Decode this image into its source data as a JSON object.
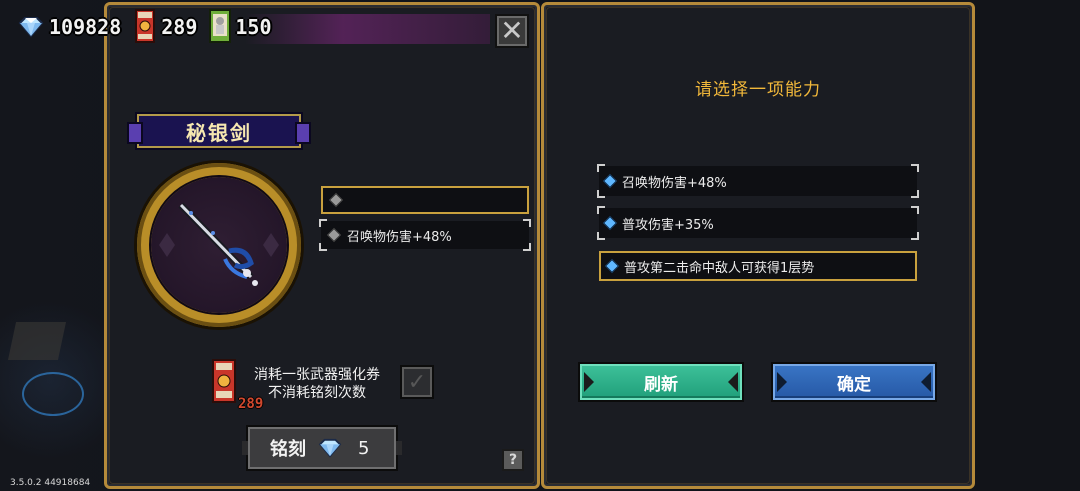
{
  "currencies": {
    "gems": "109828",
    "tickets": "289",
    "cards": "150"
  },
  "left_panel": {
    "weapon_name": "秘银剑",
    "slots": [
      {
        "text": ""
      },
      {
        "text": "召唤物伤害+48%"
      }
    ],
    "consume_line1": "消耗一张武器强化券",
    "consume_line2": "不消耗铭刻次数",
    "consume_ticket_count": "289",
    "engrave_label": "铭刻",
    "engrave_cost": "5",
    "help_label": "?"
  },
  "right_panel": {
    "title": "请选择一项能力",
    "options": [
      {
        "text": "召唤物伤害+48%"
      },
      {
        "text": "普攻伤害+35%"
      },
      {
        "text": "普攻第二击命中敌人可获得1层势"
      }
    ],
    "refresh_label": "刷新",
    "confirm_label": "确定"
  },
  "version": "3.5.0.2 44918684",
  "colors": {
    "gold_border": "#b58a3a",
    "title_orange": "#f2b83a",
    "refresh_green": "#2fb489",
    "confirm_blue": "#2f66b5",
    "diamond_blue": "#5fb7ff"
  },
  "icons": {
    "close": "close-icon",
    "gem": "gem-icon",
    "ticket": "weapon-ticket-icon",
    "card": "card-icon",
    "check": "check-icon"
  }
}
